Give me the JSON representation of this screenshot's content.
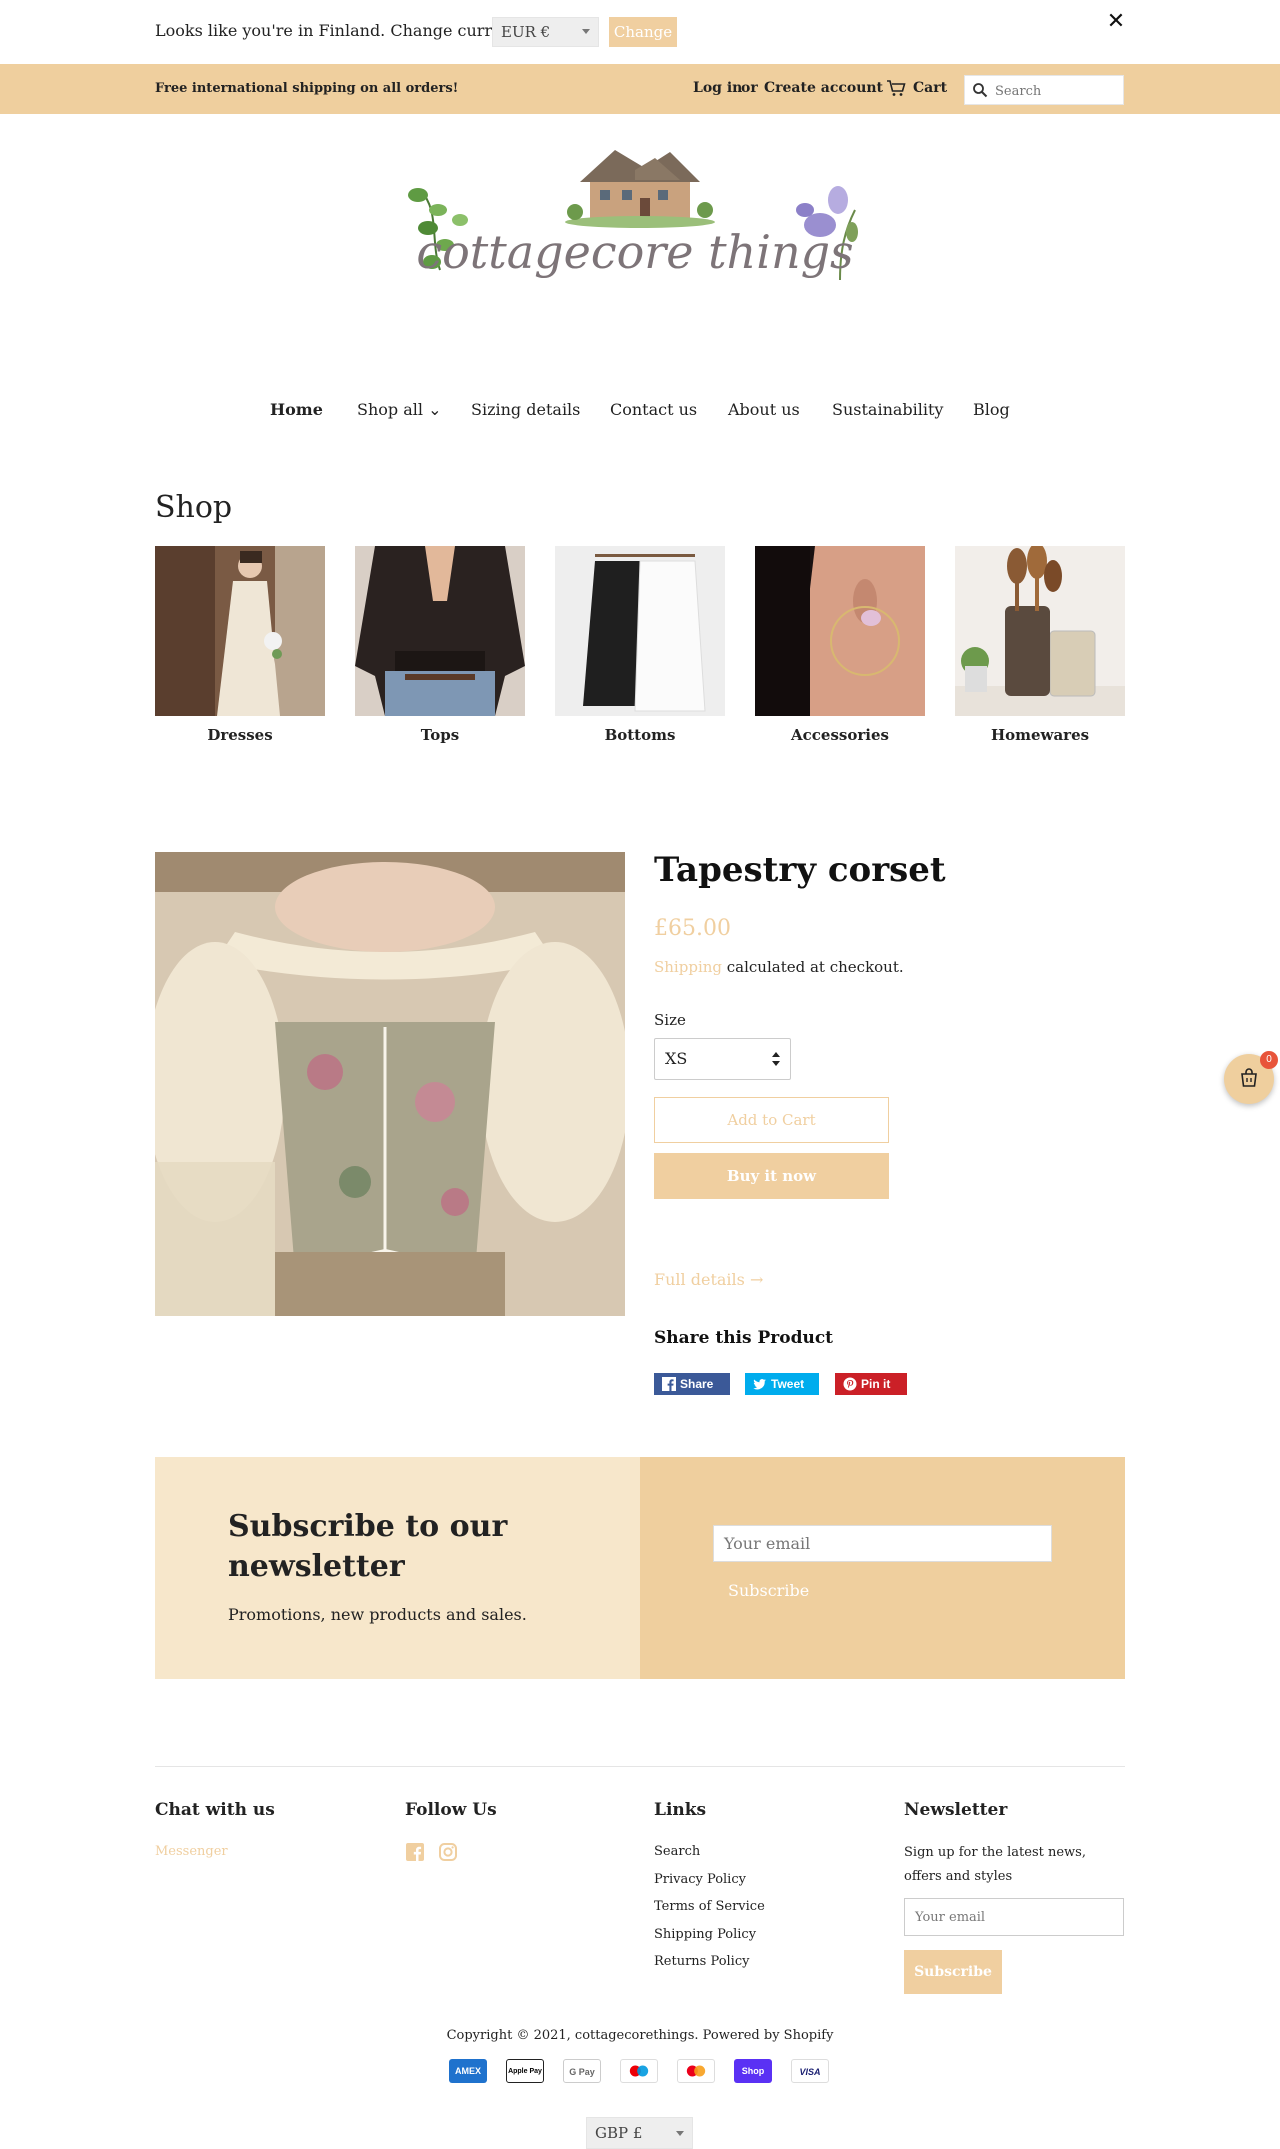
{
  "currency_bar": {
    "message": "Looks like you're in Finland. Change currency?",
    "selected_currency": "EUR €",
    "change_label": "Change",
    "close_icon": "close-icon"
  },
  "announcement": {
    "message": "Free international shipping on all orders!",
    "login": "Log in",
    "or": "or",
    "create_account": "Create account",
    "cart": "Cart",
    "search_placeholder": "Search"
  },
  "logo": {
    "text": "cottagecore things"
  },
  "nav": {
    "items": [
      {
        "label": "Home",
        "active": true
      },
      {
        "label": "Shop all ⌄"
      },
      {
        "label": "Sizing details"
      },
      {
        "label": "Contact us"
      },
      {
        "label": "About us"
      },
      {
        "label": "Sustainability"
      },
      {
        "label": "Blog"
      }
    ]
  },
  "shop": {
    "title": "Shop",
    "categories": [
      {
        "label": "Dresses"
      },
      {
        "label": "Tops"
      },
      {
        "label": "Bottoms"
      },
      {
        "label": "Accessories"
      },
      {
        "label": "Homewares"
      }
    ]
  },
  "product": {
    "title": "Tapestry corset",
    "price": "£65.00",
    "shipping_link": "Shipping",
    "shipping_rest": " calculated at checkout.",
    "size_label": "Size",
    "size_value": "XS",
    "add_to_cart": "Add to Cart",
    "buy_now": "Buy it now",
    "full_details": "Full details →",
    "share_title": "Share this Product",
    "share": {
      "facebook": "Share",
      "twitter": "Tweet",
      "pinterest": "Pin it"
    }
  },
  "floating_cart": {
    "count": "0"
  },
  "newsletter": {
    "title": "Subscribe to our newsletter",
    "subtitle": "Promotions, new products and sales.",
    "email_placeholder": "Your email",
    "subscribe": "Subscribe"
  },
  "footer": {
    "chat": {
      "heading": "Chat with us",
      "messenger": "Messenger"
    },
    "follow": {
      "heading": "Follow Us"
    },
    "links": {
      "heading": "Links",
      "items": [
        "Search",
        "Privacy Policy",
        "Terms of Service",
        "Shipping Policy",
        "Returns Policy"
      ]
    },
    "newsletter": {
      "heading": "Newsletter",
      "text": "Sign up for the latest news, offers and styles",
      "email_placeholder": "Your email",
      "subscribe": "Subscribe"
    },
    "copyright": "Copyright © 2021, cottagecorethings. Powered by Shopify",
    "payments": [
      "AMEX",
      "Apple Pay",
      "G Pay",
      "Maestro",
      "Mastercard",
      "Shop Pay",
      "VISA"
    ],
    "currency": "GBP £"
  },
  "colors": {
    "accent": "#efcf9e",
    "accent_light": "#f7e7cb",
    "facebook": "#3b5998",
    "twitter": "#00aced",
    "pinterest": "#cb2027"
  }
}
